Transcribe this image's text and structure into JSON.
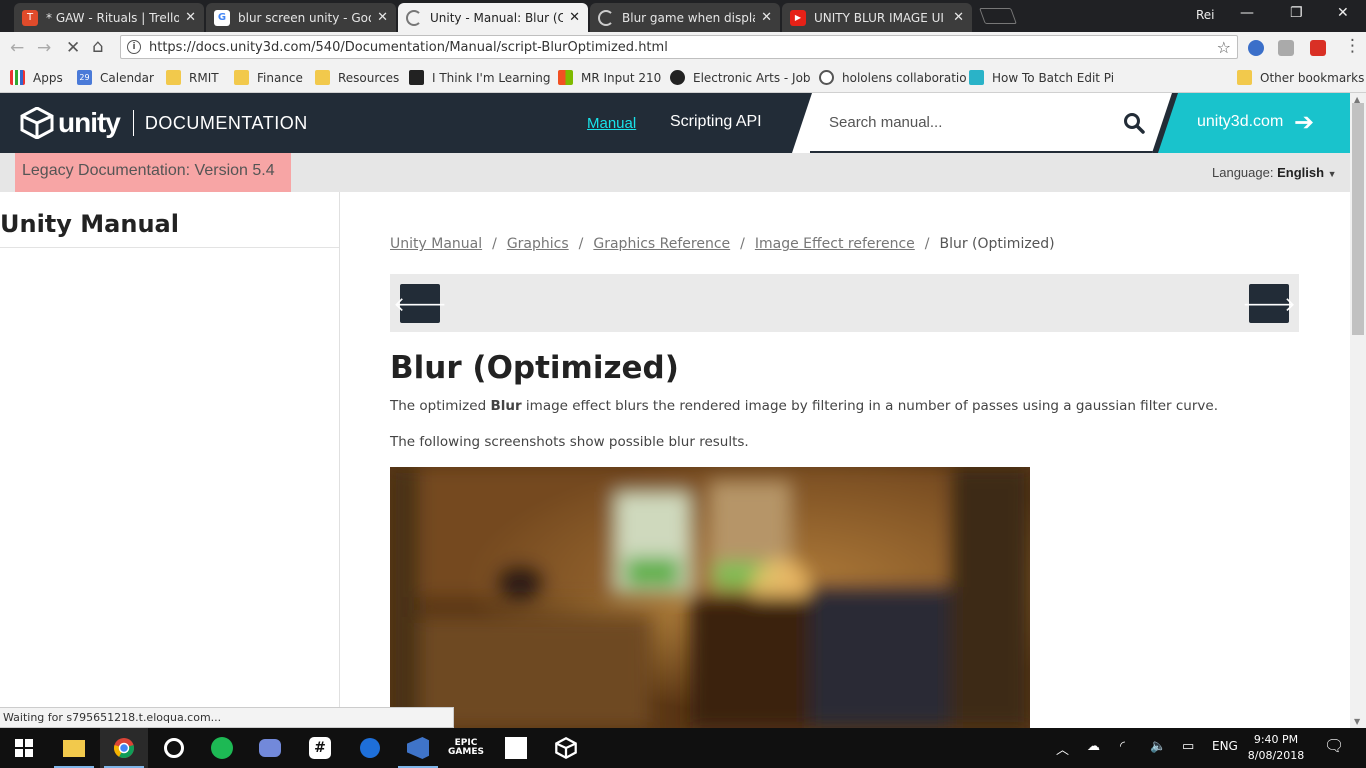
{
  "browser": {
    "tabs": [
      {
        "title": "* GAW - Rituals | Trello",
        "icon": "trello-icon",
        "active": false
      },
      {
        "title": "blur screen unity - Google",
        "icon": "google-icon",
        "active": false
      },
      {
        "title": "Unity - Manual: Blur (Opt",
        "icon": "loading-icon",
        "active": true
      },
      {
        "title": "Blur game when displayin",
        "icon": "loading-icon",
        "active": false
      },
      {
        "title": "UNITY BLUR IMAGE UI",
        "icon": "youtube-icon",
        "active": false
      }
    ],
    "profile": "Rei",
    "url": "https://docs.unity3d.com/540/Documentation/Manual/script-BlurOptimized.html",
    "bookmarks": [
      {
        "label": "Apps",
        "icon": "apps-icon"
      },
      {
        "label": "Calendar",
        "icon": "calendar-icon",
        "badge": "29"
      },
      {
        "label": "RMIT",
        "icon": "folder-icon"
      },
      {
        "label": "Finance",
        "icon": "folder-icon"
      },
      {
        "label": "Resources",
        "icon": "folder-icon"
      },
      {
        "label": "I Think I'm Learning",
        "icon": "bookmark-icon"
      },
      {
        "label": "MR Input 210",
        "icon": "microsoft-icon"
      },
      {
        "label": "Electronic Arts - Job",
        "icon": "ea-icon"
      },
      {
        "label": "hololens collaboratio",
        "icon": "google-icon"
      },
      {
        "label": "How To Batch Edit Pi",
        "icon": "plus-icon"
      },
      {
        "label": "Other bookmarks",
        "icon": "folder-icon"
      }
    ]
  },
  "header": {
    "logo_word": "unity",
    "section": "DOCUMENTATION",
    "nav_manual": "Manual",
    "nav_api": "Scripting API",
    "search_placeholder": "Search manual...",
    "site_link": "unity3d.com"
  },
  "subheader": {
    "legacy": "Legacy Documentation: Version 5.4",
    "language_label": "Language:",
    "language_value": "English"
  },
  "sidebar": {
    "title": "Unity Manual"
  },
  "breadcrumbs": [
    "Unity Manual",
    "Graphics",
    "Graphics Reference",
    "Image Effect reference"
  ],
  "breadcrumb_current": "Blur (Optimized)",
  "page": {
    "title": "Blur (Optimized)",
    "p1_before": "The optimized ",
    "p1_bold": "Blur",
    "p1_after": " image effect blurs the rendered image by filtering in a number of passes using a gaussian filter curve.",
    "p2": "The following screenshots show possible blur results."
  },
  "status_text": "Waiting for s795651218.t.eloqua.com...",
  "taskbar": {
    "language": "ENG",
    "time": "9:40 PM",
    "date": "8/08/2018"
  },
  "colors": {
    "unity_dark": "#222c37",
    "unity_cyan": "#19c3cc",
    "legacy_bg": "#f7a5a5"
  }
}
